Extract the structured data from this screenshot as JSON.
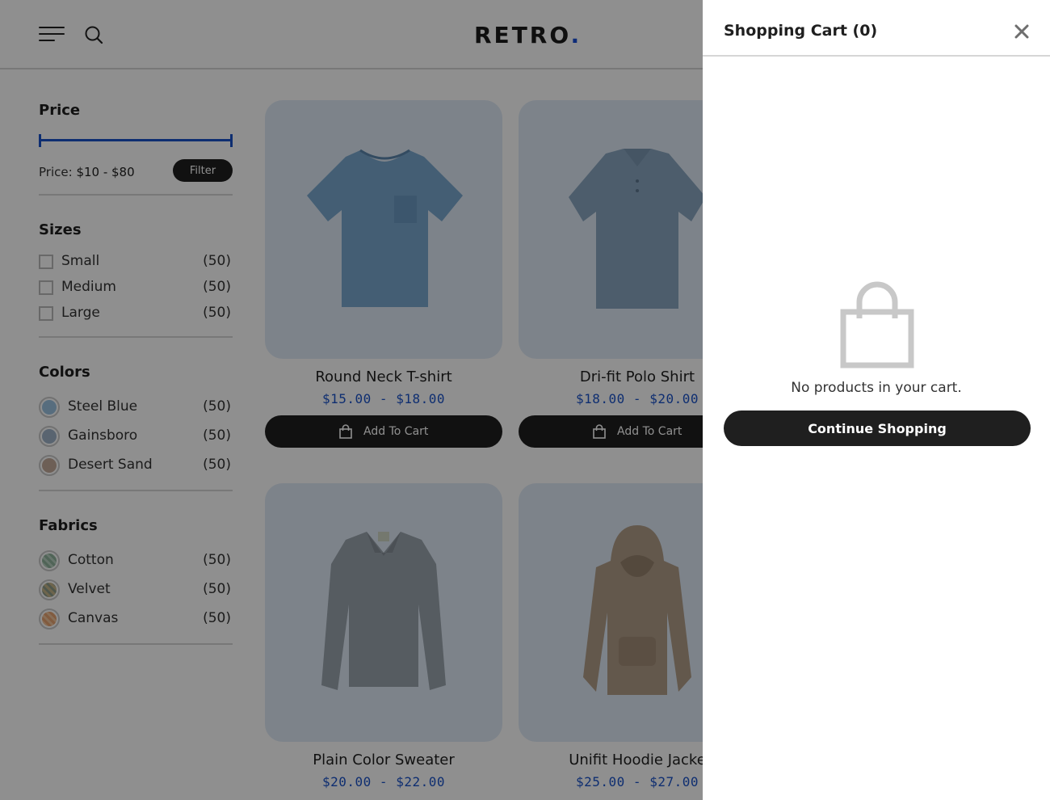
{
  "header": {
    "logo_text": "RETRO",
    "logo_dot": ".",
    "logo_accent": "#1a4fd6"
  },
  "sidebar": {
    "price": {
      "title": "Price",
      "label_prefix": "Price:",
      "range_text": "$10 - $80",
      "filter_label": "Filter"
    },
    "sizes": {
      "title": "Sizes",
      "items": [
        {
          "label": "Small",
          "count": "(50)"
        },
        {
          "label": "Medium",
          "count": "(50)"
        },
        {
          "label": "Large",
          "count": "(50)"
        }
      ]
    },
    "colors": {
      "title": "Colors",
      "items": [
        {
          "label": "Steel Blue",
          "count": "(50)",
          "hex": "#9cc3e0"
        },
        {
          "label": "Gainsboro",
          "count": "(50)",
          "hex": "#9fb3c8"
        },
        {
          "label": "Desert Sand",
          "count": "(50)",
          "hex": "#c2a99a"
        }
      ]
    },
    "fabrics": {
      "title": "Fabrics",
      "items": [
        {
          "label": "Cotton",
          "count": "(50)",
          "hex": "#8fb39c"
        },
        {
          "label": "Velvet",
          "count": "(50)",
          "hex": "#c4b48a"
        },
        {
          "label": "Canvas",
          "count": "(50)",
          "hex": "#e6a271"
        }
      ]
    }
  },
  "products": [
    {
      "name": "Round Neck T-shirt",
      "price": "$15.00 - $18.00",
      "button": "Add To Cart",
      "icon": "tshirt-image"
    },
    {
      "name": "Dri-fit Polo Shirt",
      "price": "$18.00 - $20.00",
      "button": "Add To Cart",
      "icon": "polo-image"
    },
    {
      "name": "Plain Color Sweater",
      "price": "$20.00 - $22.00",
      "icon": "sweater-image"
    },
    {
      "name": "Unifit Hoodie Jacke",
      "price": "$25.00 - $27.00",
      "icon": "hoodie-image"
    }
  ],
  "cart": {
    "title": "Shopping Cart (0)",
    "empty_message": "No products in your cart.",
    "continue_label": "Continue Shopping"
  }
}
